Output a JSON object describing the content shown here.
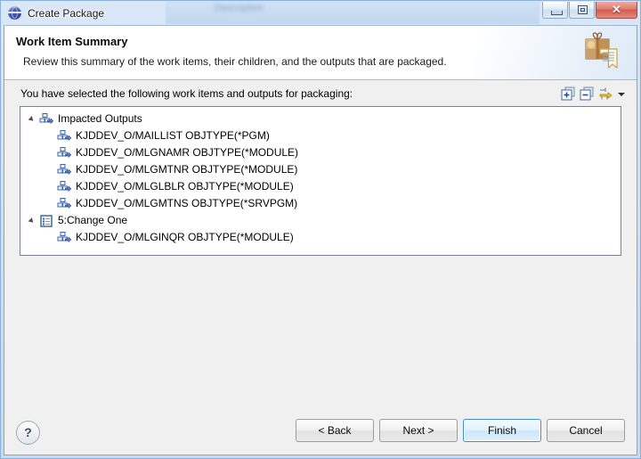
{
  "window": {
    "title": "Create Package",
    "icon": "globe-icon",
    "background_window_title": "Description",
    "controls": {
      "minimize": "minimize-button",
      "restore": "restore-button",
      "close_glyph": "✕"
    }
  },
  "banner": {
    "title": "Work Item Summary",
    "description": "Review this summary of the work items, their children, and the outputs that are packaged.",
    "icon": "package-document-icon"
  },
  "instruction": {
    "text": "You have selected the following work items and outputs for packaging:"
  },
  "toolbar": {
    "items": [
      {
        "name": "expand-all-icon",
        "tooltip": "Expand All"
      },
      {
        "name": "collapse-all-icon",
        "tooltip": "Collapse All"
      },
      {
        "name": "view-menu-icon",
        "tooltip": "View Menu"
      },
      {
        "name": "chevron-down-icon",
        "tooltip": "Menu"
      }
    ]
  },
  "tree": {
    "nodes": [
      {
        "label": "Impacted Outputs",
        "icon": "impacted-output-icon",
        "level": 0,
        "expanded": true,
        "has_twisty": true
      },
      {
        "label": "KJDDEV_O/MAILLIST OBJTYPE(*PGM)",
        "icon": "impacted-output-icon",
        "level": 1,
        "has_twisty": false
      },
      {
        "label": "KJDDEV_O/MLGNAMR OBJTYPE(*MODULE)",
        "icon": "impacted-output-icon",
        "level": 1,
        "has_twisty": false
      },
      {
        "label": "KJDDEV_O/MLGMTNR OBJTYPE(*MODULE)",
        "icon": "impacted-output-icon",
        "level": 1,
        "has_twisty": false
      },
      {
        "label": "KJDDEV_O/MLGLBLR OBJTYPE(*MODULE)",
        "icon": "impacted-output-icon",
        "level": 1,
        "has_twisty": false
      },
      {
        "label": "KJDDEV_O/MLGMTNS OBJTYPE(*SRVPGM)",
        "icon": "impacted-output-icon",
        "level": 1,
        "has_twisty": false
      },
      {
        "label": "5:Change One",
        "icon": "work-item-icon",
        "level": 0,
        "expanded": true,
        "has_twisty": true
      },
      {
        "label": "KJDDEV_O/MLGINQR OBJTYPE(*MODULE)",
        "icon": "impacted-output-icon",
        "level": 1,
        "has_twisty": false
      }
    ]
  },
  "footer": {
    "help_label": "?",
    "buttons": [
      {
        "label": "< Back",
        "name": "back-button",
        "default": false
      },
      {
        "label": "Next >",
        "name": "next-button",
        "default": false
      },
      {
        "label": "Finish",
        "name": "finish-button",
        "default": true
      },
      {
        "label": "Cancel",
        "name": "cancel-button",
        "default": false
      }
    ]
  },
  "colors": {
    "accent": "#3d90d0",
    "frame": "#c6daf1",
    "dialog_bg": "#f0f0f0",
    "panel_bg": "#ffffff",
    "icon_blue": "#4a72b8"
  }
}
